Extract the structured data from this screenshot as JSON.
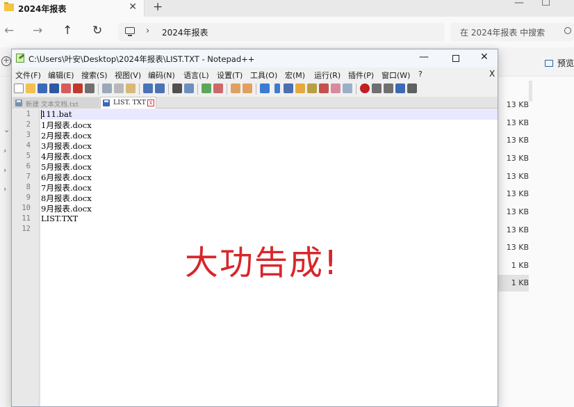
{
  "explorer": {
    "tab_title": "2024年报表",
    "tab_close": "✕",
    "new_tab": "+",
    "nav": {
      "back": "←",
      "forward": "→",
      "up": "↑",
      "refresh": "↻"
    },
    "breadcrumb_sep": "›",
    "breadcrumb": "2024年报表",
    "search_placeholder": "在 2024年报表 中搜索",
    "preview_label": "预览",
    "add_button": "+",
    "side_chevrons": [
      "⌄",
      "›",
      "›",
      "›"
    ],
    "sizes": [
      "13 KB",
      "13 KB",
      "13 KB",
      "13 KB",
      "13 KB",
      "13 KB",
      "13 KB",
      "13 KB",
      "13 KB",
      "1 KB",
      "1 KB"
    ]
  },
  "notepad": {
    "title": "C:\\Users\\叶安\\Desktop\\2024年报表\\LIST.TXT - Notepad++",
    "window_controls": {
      "minimize": "—",
      "close": "✕"
    },
    "menu": [
      "文件(F)",
      "编辑(E)",
      "搜索(S)",
      "视图(V)",
      "编码(N)",
      "语言(L)",
      "设置(T)",
      "工具(O)",
      "宏(M)",
      "运行(R)",
      "插件(P)",
      "窗口(W)",
      "?"
    ],
    "menu_close": "X",
    "tabs": [
      {
        "label": "新建 文本文档.txt"
      },
      {
        "label": "LIST. TXT"
      }
    ],
    "tab_close_glyph": "x",
    "lines": [
      "111.bat",
      "1月报表.docx",
      "2月报表.docx",
      "3月报表.docx",
      "4月报表.docx",
      "5月报表.docx",
      "6月报表.docx",
      "7月报表.docx",
      "8月报表.docx",
      "9月报表.docx",
      "LIST.TXT",
      ""
    ],
    "line_numbers": [
      "1",
      "2",
      "3",
      "4",
      "5",
      "6",
      "7",
      "8",
      "9",
      "10",
      "11",
      "12"
    ]
  },
  "overlay_text": "大功告成!",
  "colors": {
    "overlay": "#d8262a",
    "current_line": "#e8e8ff",
    "tab_close": "#c83232"
  }
}
